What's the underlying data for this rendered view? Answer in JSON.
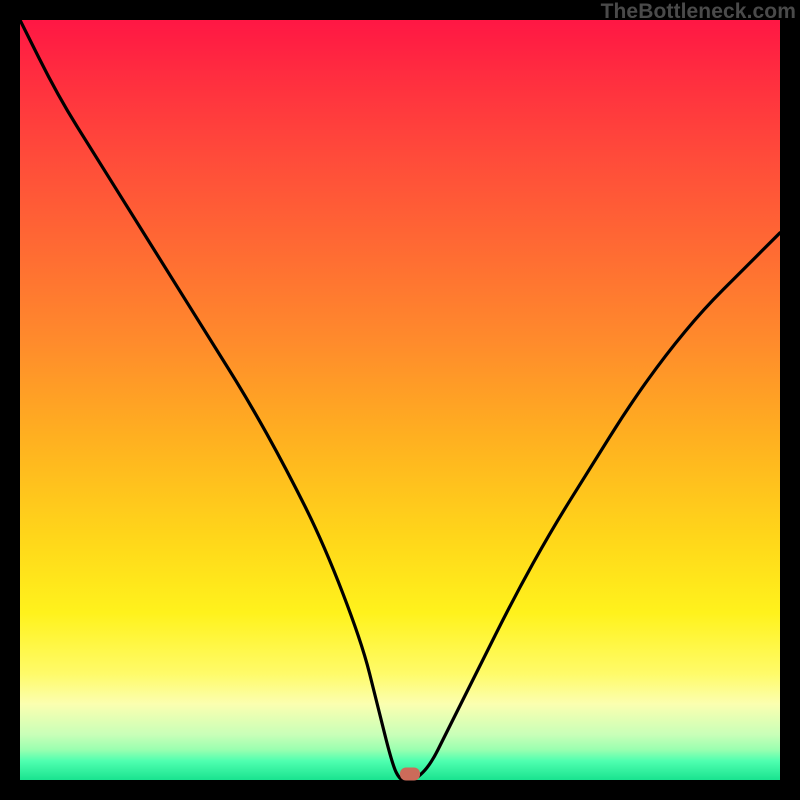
{
  "watermark": "TheBottleneck.com",
  "marker": {
    "x_frac": 0.513,
    "y_frac": 0.992,
    "color": "#cc6b5a"
  },
  "chart_data": {
    "type": "line",
    "title": "",
    "xlabel": "",
    "ylabel": "",
    "xlim": [
      0,
      100
    ],
    "ylim": [
      0,
      100
    ],
    "series": [
      {
        "name": "bottleneck-curve",
        "x": [
          0,
          5,
          10,
          15,
          20,
          25,
          30,
          35,
          40,
          45,
          47,
          49,
          50,
          51,
          52,
          54,
          56,
          60,
          65,
          70,
          75,
          80,
          85,
          90,
          95,
          100
        ],
        "y": [
          100,
          90,
          82,
          74,
          66,
          58,
          50,
          41,
          31,
          18,
          10,
          2,
          0,
          0,
          0,
          2,
          6,
          14,
          24,
          33,
          41,
          49,
          56,
          62,
          67,
          72
        ]
      }
    ],
    "annotations": [
      {
        "type": "marker",
        "x": 51.3,
        "y": 0.8,
        "label": "optimal-point"
      }
    ],
    "background_gradient": {
      "orientation": "vertical",
      "stops": [
        {
          "pos": 0.0,
          "color": "#ff1744"
        },
        {
          "pos": 0.3,
          "color": "#ff6a33"
        },
        {
          "pos": 0.68,
          "color": "#ffd61a"
        },
        {
          "pos": 0.86,
          "color": "#fffb69"
        },
        {
          "pos": 0.96,
          "color": "#9affb0"
        },
        {
          "pos": 1.0,
          "color": "#19e38f"
        }
      ]
    }
  }
}
